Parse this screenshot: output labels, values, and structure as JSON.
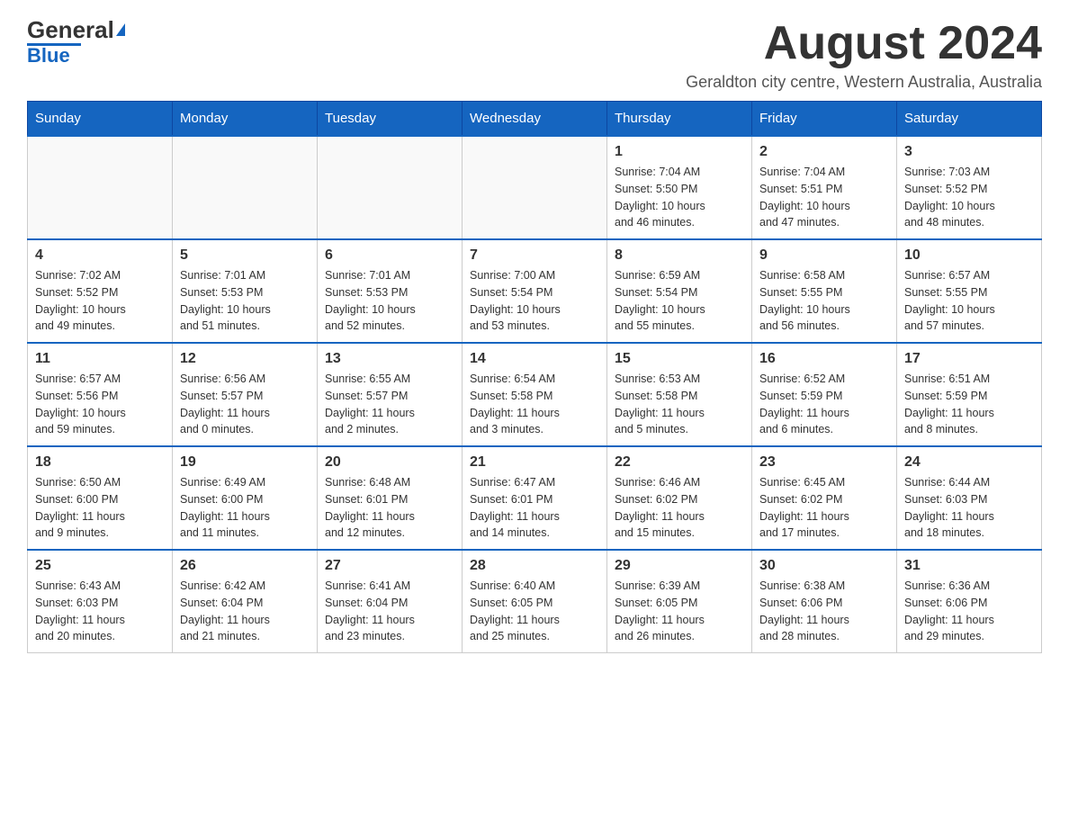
{
  "header": {
    "logo_general": "General",
    "logo_blue": "Blue",
    "month_year": "August 2024",
    "location": "Geraldton city centre, Western Australia, Australia"
  },
  "weekdays": [
    "Sunday",
    "Monday",
    "Tuesday",
    "Wednesday",
    "Thursday",
    "Friday",
    "Saturday"
  ],
  "weeks": [
    [
      {
        "day": "",
        "info": ""
      },
      {
        "day": "",
        "info": ""
      },
      {
        "day": "",
        "info": ""
      },
      {
        "day": "",
        "info": ""
      },
      {
        "day": "1",
        "info": "Sunrise: 7:04 AM\nSunset: 5:50 PM\nDaylight: 10 hours\nand 46 minutes."
      },
      {
        "day": "2",
        "info": "Sunrise: 7:04 AM\nSunset: 5:51 PM\nDaylight: 10 hours\nand 47 minutes."
      },
      {
        "day": "3",
        "info": "Sunrise: 7:03 AM\nSunset: 5:52 PM\nDaylight: 10 hours\nand 48 minutes."
      }
    ],
    [
      {
        "day": "4",
        "info": "Sunrise: 7:02 AM\nSunset: 5:52 PM\nDaylight: 10 hours\nand 49 minutes."
      },
      {
        "day": "5",
        "info": "Sunrise: 7:01 AM\nSunset: 5:53 PM\nDaylight: 10 hours\nand 51 minutes."
      },
      {
        "day": "6",
        "info": "Sunrise: 7:01 AM\nSunset: 5:53 PM\nDaylight: 10 hours\nand 52 minutes."
      },
      {
        "day": "7",
        "info": "Sunrise: 7:00 AM\nSunset: 5:54 PM\nDaylight: 10 hours\nand 53 minutes."
      },
      {
        "day": "8",
        "info": "Sunrise: 6:59 AM\nSunset: 5:54 PM\nDaylight: 10 hours\nand 55 minutes."
      },
      {
        "day": "9",
        "info": "Sunrise: 6:58 AM\nSunset: 5:55 PM\nDaylight: 10 hours\nand 56 minutes."
      },
      {
        "day": "10",
        "info": "Sunrise: 6:57 AM\nSunset: 5:55 PM\nDaylight: 10 hours\nand 57 minutes."
      }
    ],
    [
      {
        "day": "11",
        "info": "Sunrise: 6:57 AM\nSunset: 5:56 PM\nDaylight: 10 hours\nand 59 minutes."
      },
      {
        "day": "12",
        "info": "Sunrise: 6:56 AM\nSunset: 5:57 PM\nDaylight: 11 hours\nand 0 minutes."
      },
      {
        "day": "13",
        "info": "Sunrise: 6:55 AM\nSunset: 5:57 PM\nDaylight: 11 hours\nand 2 minutes."
      },
      {
        "day": "14",
        "info": "Sunrise: 6:54 AM\nSunset: 5:58 PM\nDaylight: 11 hours\nand 3 minutes."
      },
      {
        "day": "15",
        "info": "Sunrise: 6:53 AM\nSunset: 5:58 PM\nDaylight: 11 hours\nand 5 minutes."
      },
      {
        "day": "16",
        "info": "Sunrise: 6:52 AM\nSunset: 5:59 PM\nDaylight: 11 hours\nand 6 minutes."
      },
      {
        "day": "17",
        "info": "Sunrise: 6:51 AM\nSunset: 5:59 PM\nDaylight: 11 hours\nand 8 minutes."
      }
    ],
    [
      {
        "day": "18",
        "info": "Sunrise: 6:50 AM\nSunset: 6:00 PM\nDaylight: 11 hours\nand 9 minutes."
      },
      {
        "day": "19",
        "info": "Sunrise: 6:49 AM\nSunset: 6:00 PM\nDaylight: 11 hours\nand 11 minutes."
      },
      {
        "day": "20",
        "info": "Sunrise: 6:48 AM\nSunset: 6:01 PM\nDaylight: 11 hours\nand 12 minutes."
      },
      {
        "day": "21",
        "info": "Sunrise: 6:47 AM\nSunset: 6:01 PM\nDaylight: 11 hours\nand 14 minutes."
      },
      {
        "day": "22",
        "info": "Sunrise: 6:46 AM\nSunset: 6:02 PM\nDaylight: 11 hours\nand 15 minutes."
      },
      {
        "day": "23",
        "info": "Sunrise: 6:45 AM\nSunset: 6:02 PM\nDaylight: 11 hours\nand 17 minutes."
      },
      {
        "day": "24",
        "info": "Sunrise: 6:44 AM\nSunset: 6:03 PM\nDaylight: 11 hours\nand 18 minutes."
      }
    ],
    [
      {
        "day": "25",
        "info": "Sunrise: 6:43 AM\nSunset: 6:03 PM\nDaylight: 11 hours\nand 20 minutes."
      },
      {
        "day": "26",
        "info": "Sunrise: 6:42 AM\nSunset: 6:04 PM\nDaylight: 11 hours\nand 21 minutes."
      },
      {
        "day": "27",
        "info": "Sunrise: 6:41 AM\nSunset: 6:04 PM\nDaylight: 11 hours\nand 23 minutes."
      },
      {
        "day": "28",
        "info": "Sunrise: 6:40 AM\nSunset: 6:05 PM\nDaylight: 11 hours\nand 25 minutes."
      },
      {
        "day": "29",
        "info": "Sunrise: 6:39 AM\nSunset: 6:05 PM\nDaylight: 11 hours\nand 26 minutes."
      },
      {
        "day": "30",
        "info": "Sunrise: 6:38 AM\nSunset: 6:06 PM\nDaylight: 11 hours\nand 28 minutes."
      },
      {
        "day": "31",
        "info": "Sunrise: 6:36 AM\nSunset: 6:06 PM\nDaylight: 11 hours\nand 29 minutes."
      }
    ]
  ]
}
